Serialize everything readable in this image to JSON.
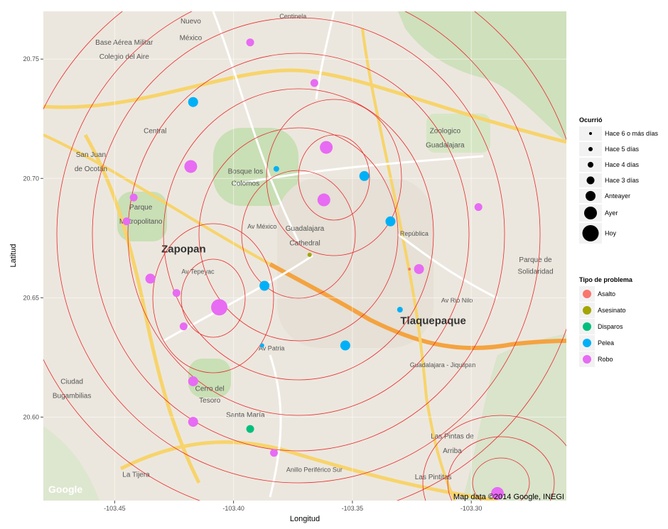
{
  "chart_data": {
    "type": "scatter",
    "title": "",
    "xlabel": "Longitud",
    "ylabel": "Latitud",
    "xlim": [
      -103.48,
      -103.26
    ],
    "ylim": [
      20.565,
      20.77
    ],
    "x_ticks": [
      -103.45,
      -103.4,
      -103.35,
      -103.3
    ],
    "x_tick_labels": [
      "-103.45",
      "-103.40",
      "-103.35",
      "-103.30"
    ],
    "y_ticks": [
      20.6,
      20.65,
      20.7,
      20.75
    ],
    "y_tick_labels": [
      "20.60",
      "20.65",
      "20.70",
      "20.75"
    ],
    "grid": true,
    "legend_position": "right",
    "size_legend": {
      "title": "Ocurrió",
      "items": [
        {
          "label": "Hace 6 o más días",
          "level": 1
        },
        {
          "label": "Hace 5 días",
          "level": 2
        },
        {
          "label": "Hace 4 días",
          "level": 3
        },
        {
          "label": "Hace 3 días",
          "level": 4
        },
        {
          "label": "Anteayer",
          "level": 5
        },
        {
          "label": "Ayer",
          "level": 6
        },
        {
          "label": "Hoy",
          "level": 7
        }
      ]
    },
    "color_legend": {
      "title": "Tipo de problema",
      "items": [
        {
          "label": "Asalto",
          "color": "#F8766D"
        },
        {
          "label": "Asesinato",
          "color": "#A3A500"
        },
        {
          "label": "Disparos",
          "color": "#00BF7D"
        },
        {
          "label": "Pelea",
          "color": "#00B0F6"
        },
        {
          "label": "Robo",
          "color": "#E76BF3"
        }
      ]
    },
    "points": [
      {
        "x": -103.393,
        "y": 20.757,
        "type": "Robo",
        "level": 4
      },
      {
        "x": -103.366,
        "y": 20.74,
        "type": "Robo",
        "level": 4
      },
      {
        "x": -103.417,
        "y": 20.732,
        "type": "Pelea",
        "level": 5
      },
      {
        "x": -103.361,
        "y": 20.713,
        "type": "Robo",
        "level": 6
      },
      {
        "x": -103.418,
        "y": 20.705,
        "type": "Robo",
        "level": 6
      },
      {
        "x": -103.382,
        "y": 20.704,
        "type": "Pelea",
        "level": 3
      },
      {
        "x": -103.345,
        "y": 20.701,
        "type": "Pelea",
        "level": 5
      },
      {
        "x": -103.362,
        "y": 20.691,
        "type": "Robo",
        "level": 6
      },
      {
        "x": -103.442,
        "y": 20.692,
        "type": "Robo",
        "level": 4
      },
      {
        "x": -103.297,
        "y": 20.688,
        "type": "Robo",
        "level": 4
      },
      {
        "x": -103.445,
        "y": 20.682,
        "type": "Robo",
        "level": 4
      },
      {
        "x": -103.334,
        "y": 20.682,
        "type": "Pelea",
        "level": 5
      },
      {
        "x": -103.368,
        "y": 20.668,
        "type": "Asesinato",
        "level": 2
      },
      {
        "x": -103.322,
        "y": 20.662,
        "type": "Robo",
        "level": 5
      },
      {
        "x": -103.326,
        "y": 20.662,
        "type": "Asalto",
        "level": 1
      },
      {
        "x": -103.435,
        "y": 20.658,
        "type": "Robo",
        "level": 5
      },
      {
        "x": -103.387,
        "y": 20.655,
        "type": "Pelea",
        "level": 5
      },
      {
        "x": -103.424,
        "y": 20.652,
        "type": "Robo",
        "level": 4
      },
      {
        "x": -103.406,
        "y": 20.646,
        "type": "Robo",
        "level": 7
      },
      {
        "x": -103.33,
        "y": 20.645,
        "type": "Pelea",
        "level": 3
      },
      {
        "x": -103.421,
        "y": 20.638,
        "type": "Robo",
        "level": 4
      },
      {
        "x": -103.388,
        "y": 20.63,
        "type": "Pelea",
        "level": 2
      },
      {
        "x": -103.353,
        "y": 20.63,
        "type": "Pelea",
        "level": 5
      },
      {
        "x": -103.417,
        "y": 20.615,
        "type": "Robo",
        "level": 5
      },
      {
        "x": -103.417,
        "y": 20.598,
        "type": "Robo",
        "level": 5
      },
      {
        "x": -103.393,
        "y": 20.595,
        "type": "Disparos",
        "level": 4
      },
      {
        "x": -103.383,
        "y": 20.585,
        "type": "Robo",
        "level": 4
      },
      {
        "x": -103.289,
        "y": 20.568,
        "type": "Robo",
        "level": 6
      }
    ]
  },
  "map": {
    "labels": [
      {
        "text": "Nuevo",
        "lon": -103.418,
        "lat": 20.765,
        "kind": "place"
      },
      {
        "text": "México",
        "lon": -103.418,
        "lat": 20.758,
        "kind": "place"
      },
      {
        "text": "Base Aérea Militar",
        "lon": -103.446,
        "lat": 20.756,
        "kind": "place"
      },
      {
        "text": "Colegio del Aire",
        "lon": -103.446,
        "lat": 20.75,
        "kind": "place"
      },
      {
        "text": "Zoologico",
        "lon": -103.311,
        "lat": 20.719,
        "kind": "place"
      },
      {
        "text": "Guadalajara",
        "lon": -103.311,
        "lat": 20.713,
        "kind": "place"
      },
      {
        "text": "San Juan",
        "lon": -103.46,
        "lat": 20.709,
        "kind": "place"
      },
      {
        "text": "de Ocotán",
        "lon": -103.46,
        "lat": 20.703,
        "kind": "place"
      },
      {
        "text": "Parque",
        "lon": -103.439,
        "lat": 20.687,
        "kind": "park"
      },
      {
        "text": "Metropolitano",
        "lon": -103.439,
        "lat": 20.681,
        "kind": "park"
      },
      {
        "text": "Zapopan",
        "lon": -103.421,
        "lat": 20.669,
        "kind": "city"
      },
      {
        "text": "Guadalajara",
        "lon": -103.37,
        "lat": 20.678,
        "kind": "place"
      },
      {
        "text": "Cathedral",
        "lon": -103.37,
        "lat": 20.672,
        "kind": "place"
      },
      {
        "text": "Bosque los",
        "lon": -103.395,
        "lat": 20.702,
        "kind": "park"
      },
      {
        "text": "Colomos",
        "lon": -103.395,
        "lat": 20.697,
        "kind": "park"
      },
      {
        "text": "Tlaquepaque",
        "lon": -103.316,
        "lat": 20.639,
        "kind": "city"
      },
      {
        "text": "Ciudad",
        "lon": -103.468,
        "lat": 20.614,
        "kind": "place"
      },
      {
        "text": "Bugambilias",
        "lon": -103.468,
        "lat": 20.608,
        "kind": "place"
      },
      {
        "text": "Cerro del",
        "lon": -103.41,
        "lat": 20.611,
        "kind": "park"
      },
      {
        "text": "Tesoro",
        "lon": -103.41,
        "lat": 20.606,
        "kind": "park"
      },
      {
        "text": "Santa María",
        "lon": -103.395,
        "lat": 20.6,
        "kind": "place"
      },
      {
        "text": "Las Pintas de",
        "lon": -103.308,
        "lat": 20.591,
        "kind": "place"
      },
      {
        "text": "Arriba",
        "lon": -103.308,
        "lat": 20.585,
        "kind": "place"
      },
      {
        "text": "Las Pintitas",
        "lon": -103.316,
        "lat": 20.574,
        "kind": "place"
      },
      {
        "text": "La Tijera",
        "lon": -103.441,
        "lat": 20.575,
        "kind": "place"
      },
      {
        "text": "Parque de",
        "lon": -103.273,
        "lat": 20.665,
        "kind": "place"
      },
      {
        "text": "Solidaridad",
        "lon": -103.273,
        "lat": 20.66,
        "kind": "place"
      },
      {
        "text": "Central",
        "lon": -103.433,
        "lat": 20.719,
        "kind": "place"
      },
      {
        "text": "Av México",
        "lon": -103.388,
        "lat": 20.679,
        "kind": "road"
      },
      {
        "text": "Av Tepeyac",
        "lon": -103.415,
        "lat": 20.66,
        "kind": "road"
      },
      {
        "text": "Av Patria",
        "lon": -103.384,
        "lat": 20.628,
        "kind": "road"
      },
      {
        "text": "Av Rio Nilo",
        "lon": -103.306,
        "lat": 20.648,
        "kind": "road"
      },
      {
        "text": "Anillo Periférico Sur",
        "lon": -103.366,
        "lat": 20.577,
        "kind": "road"
      },
      {
        "text": "Guadalajara - Jiquilpan",
        "lon": -103.312,
        "lat": 20.621,
        "kind": "road"
      },
      {
        "text": "República",
        "lon": -103.324,
        "lat": 20.676,
        "kind": "road"
      },
      {
        "text": "Centinela",
        "lon": -103.375,
        "lat": 20.767,
        "kind": "road"
      }
    ],
    "attribution": "Map data ©2014 Google, INEGI",
    "logo": "Google"
  }
}
